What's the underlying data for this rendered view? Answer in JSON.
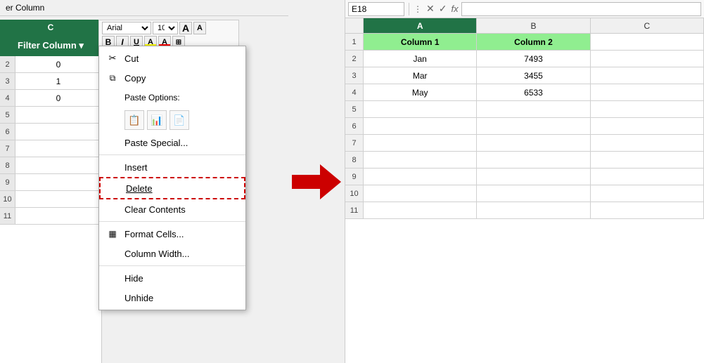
{
  "left_panel": {
    "title": "er Column",
    "col_label": "C",
    "filter_label": "Filter Column ▾",
    "rows": [
      {
        "row_num": "",
        "value": ""
      },
      {
        "row_num": "2",
        "value": "0"
      },
      {
        "row_num": "3",
        "value": "1"
      },
      {
        "row_num": "4",
        "value": "0"
      }
    ]
  },
  "toolbar": {
    "font_name": "Arial",
    "font_size": "10",
    "bold_label": "B",
    "italic_label": "I",
    "underline_label": "U",
    "highlight_label": "A",
    "font_color_label": "A"
  },
  "context_menu": {
    "items": [
      {
        "id": "cut",
        "label": "Cut",
        "icon": "✂",
        "has_icon": true
      },
      {
        "id": "copy",
        "label": "Copy",
        "icon": "📋",
        "has_icon": true
      },
      {
        "id": "paste-options-header",
        "label": "Paste Options:",
        "icon": "",
        "has_icon": false
      },
      {
        "id": "paste-special",
        "label": "Paste Special...",
        "icon": "",
        "has_icon": false
      },
      {
        "id": "insert",
        "label": "Insert",
        "icon": "",
        "has_icon": false
      },
      {
        "id": "delete",
        "label": "Delete",
        "icon": "",
        "has_icon": false
      },
      {
        "id": "clear-contents",
        "label": "Clear Contents",
        "icon": "",
        "has_icon": false
      },
      {
        "id": "format-cells",
        "label": "Format Cells...",
        "icon": "▦",
        "has_icon": true
      },
      {
        "id": "column-width",
        "label": "Column Width...",
        "icon": "",
        "has_icon": false
      },
      {
        "id": "hide",
        "label": "Hide",
        "icon": "",
        "has_icon": false
      },
      {
        "id": "unhide",
        "label": "Unhide",
        "icon": "",
        "has_icon": false
      }
    ]
  },
  "arrow": {
    "color": "#cc0000"
  },
  "right_panel": {
    "name_box": "E18",
    "formula_bar_value": "",
    "columns": [
      "A",
      "B",
      "C"
    ],
    "rows": [
      {
        "row_num": "1",
        "col_a": "Column 1",
        "col_b": "Column 2",
        "col_c": "",
        "a_header": true,
        "b_header": true
      },
      {
        "row_num": "2",
        "col_a": "Jan",
        "col_b": "7493",
        "col_c": "",
        "a_header": false,
        "b_header": false
      },
      {
        "row_num": "3",
        "col_a": "Mar",
        "col_b": "3455",
        "col_c": "",
        "a_header": false,
        "b_header": false
      },
      {
        "row_num": "4",
        "col_a": "May",
        "col_b": "6533",
        "col_c": "",
        "a_header": false,
        "b_header": false
      },
      {
        "row_num": "5",
        "col_a": "",
        "col_b": "",
        "col_c": ""
      },
      {
        "row_num": "6",
        "col_a": "",
        "col_b": "",
        "col_c": ""
      },
      {
        "row_num": "7",
        "col_a": "",
        "col_b": "",
        "col_c": ""
      },
      {
        "row_num": "8",
        "col_a": "",
        "col_b": "",
        "col_c": ""
      },
      {
        "row_num": "9",
        "col_a": "",
        "col_b": "",
        "col_c": ""
      },
      {
        "row_num": "10",
        "col_a": "",
        "col_b": "",
        "col_c": ""
      },
      {
        "row_num": "11",
        "col_a": "",
        "col_b": "",
        "col_c": ""
      }
    ]
  }
}
